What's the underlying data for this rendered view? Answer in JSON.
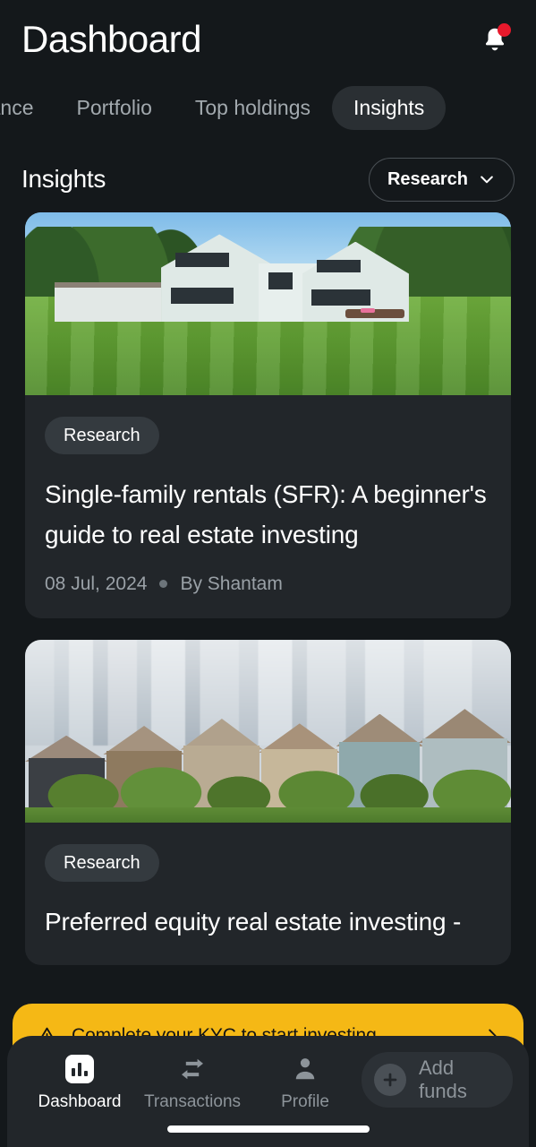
{
  "header": {
    "title": "Dashboard",
    "bell_icon": "bell-icon",
    "notification_dot": true
  },
  "tabs": [
    {
      "label": "ormance",
      "active": false
    },
    {
      "label": "Portfolio",
      "active": false
    },
    {
      "label": "Top holdings",
      "active": false
    },
    {
      "label": "Insights",
      "active": true
    }
  ],
  "section": {
    "title": "Insights",
    "filter": {
      "label": "Research",
      "chevron_icon": "chevron-down-icon"
    }
  },
  "articles": [
    {
      "image": "suburban-house-with-lawn-photo",
      "badge": "Research",
      "title": "Single-family rentals (SFR): A beginner's guide to real estate investing",
      "date": "08 Jul, 2024",
      "author": "By Shantam"
    },
    {
      "image": "painted-ladies-victorian-houses-san-francisco-photo",
      "badge": "Research",
      "title": "Preferred equity real estate investing -",
      "date": "",
      "author": ""
    }
  ],
  "kyc_banner": {
    "warning_icon": "warning-triangle-icon",
    "text": "Complete your KYC to start investing.",
    "chevron_icon": "chevron-right-icon"
  },
  "bottom_nav": {
    "items": [
      {
        "label": "Dashboard",
        "icon": "bar-chart-icon",
        "active": true
      },
      {
        "label": "Transactions",
        "icon": "swap-arrows-icon",
        "active": false
      },
      {
        "label": "Profile",
        "icon": "person-icon",
        "active": false
      }
    ],
    "add_funds": {
      "label": "Add funds",
      "icon": "plus-circle-icon"
    }
  },
  "colors": {
    "background": "#14181b",
    "card": "#22262a",
    "badge": "#343a3f",
    "accent_yellow": "#f5b815",
    "notification_red": "#e8192c",
    "text_primary": "#ffffff",
    "text_muted": "#9aa1a7"
  }
}
